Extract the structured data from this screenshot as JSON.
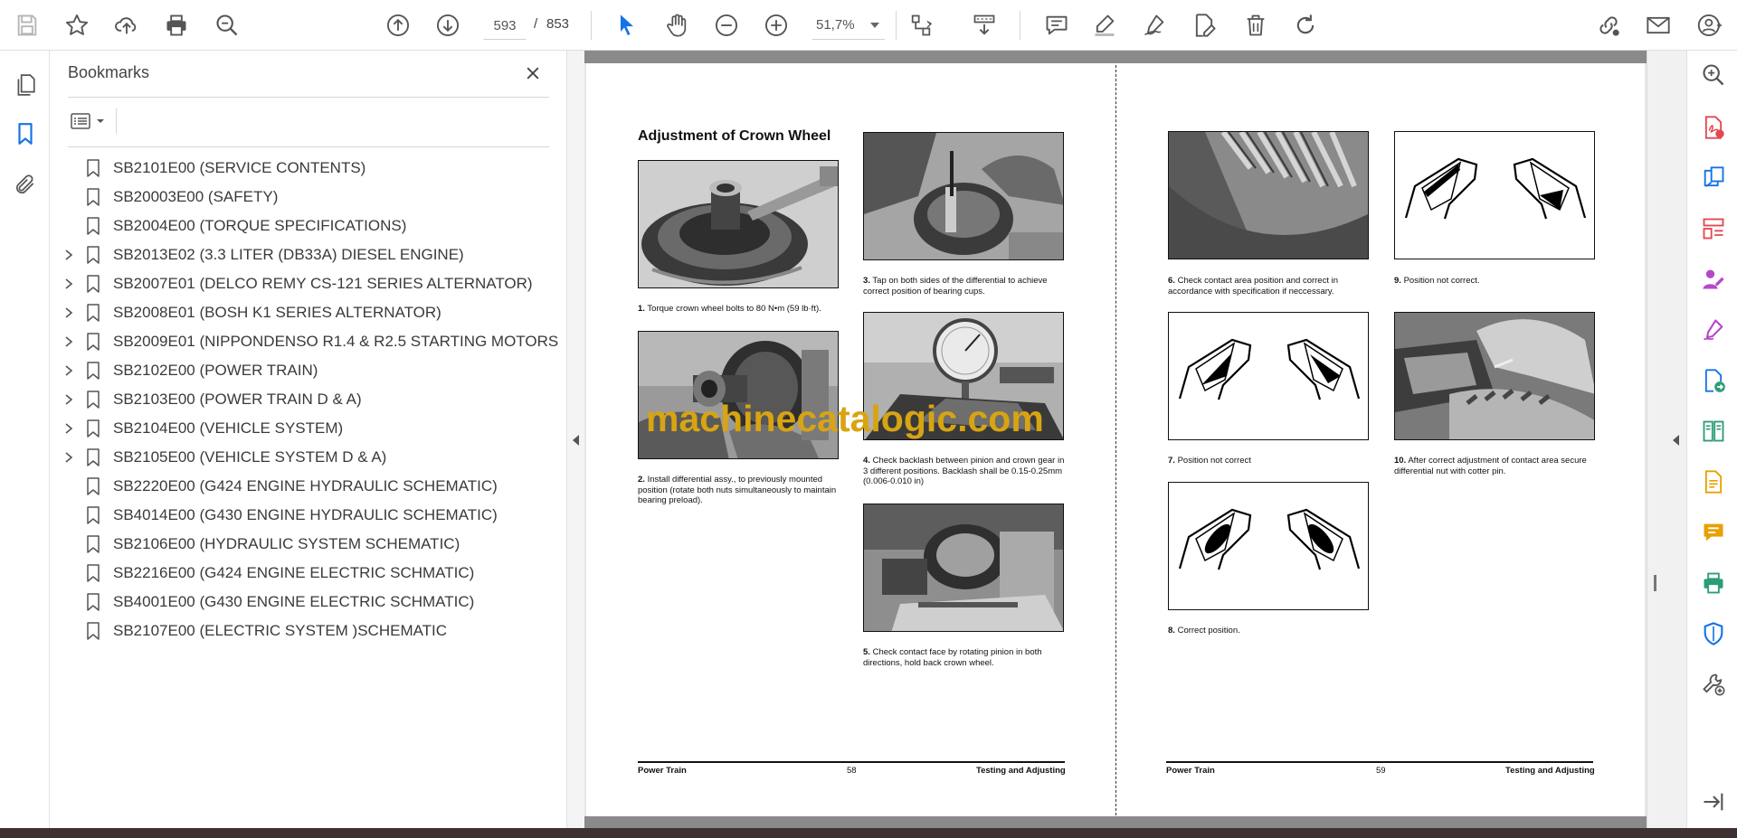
{
  "toolbar": {
    "current_page": "593",
    "separator": "/",
    "total_pages": "853",
    "zoom": "51,7%"
  },
  "bookmarks": {
    "title": "Bookmarks",
    "items": [
      {
        "label": "SB2101E00 (SERVICE CONTENTS)",
        "expandable": false
      },
      {
        "label": "SB20003E00 (SAFETY)",
        "expandable": false
      },
      {
        "label": "SB2004E00 (TORQUE SPECIFICATIONS)",
        "expandable": false
      },
      {
        "label": "SB2013E02 (3.3 LITER (DB33A) DIESEL ENGINE)",
        "expandable": true
      },
      {
        "label": "SB2007E01 (DELCO REMY CS-121 SERIES ALTERNATOR)",
        "expandable": true
      },
      {
        "label": "SB2008E01 (BOSH K1 SERIES ALTERNATOR)",
        "expandable": true
      },
      {
        "label": "SB2009E01 (NIPPONDENSO R1.4 & R2.5 STARTING MOTORS",
        "expandable": true
      },
      {
        "label": "SB2102E00 (POWER TRAIN)",
        "expandable": true
      },
      {
        "label": "SB2103E00 (POWER TRAIN D & A)",
        "expandable": true
      },
      {
        "label": "SB2104E00 (VEHICLE SYSTEM)",
        "expandable": true
      },
      {
        "label": "SB2105E00 (VEHICLE SYSTEM D & A)",
        "expandable": true
      },
      {
        "label": "SB2220E00 (G424 ENGINE HYDRAULIC SCHEMATIC)",
        "expandable": false
      },
      {
        "label": "SB4014E00 (G430 ENGINE HYDRAULIC SCHEMATIC)",
        "expandable": false
      },
      {
        "label": "SB2106E00 (HYDRAULIC SYSTEM SCHEMATIC)",
        "expandable": false
      },
      {
        "label": "SB2216E00 (G424 ENGINE ELECTRIC SCHMATIC)",
        "expandable": false
      },
      {
        "label": "SB4001E00 (G430 ENGINE ELECTRIC SCHMATIC)",
        "expandable": false
      },
      {
        "label": "SB2107E00 (ELECTRIC SYSTEM )SCHEMATIC",
        "expandable": false
      }
    ]
  },
  "document": {
    "left_page": {
      "heading": "Adjustment of Crown Wheel",
      "captions": [
        {
          "num": "1.",
          "text": "Torque crown wheel bolts to 80 N•m (59 lb·ft)."
        },
        {
          "num": "2.",
          "text": "Install differential assy., to previously mounted position (rotate both nuts simultaneously to maintain bearing preload)."
        },
        {
          "num": "3.",
          "text": "Tap on both sides of the differential to achieve correct position of bearing cups."
        },
        {
          "num": "4.",
          "text": "Check backlash between pinion and crown gear in 3 different positions. Backlash shall be 0.15-0.25mm (0.006-0.010 in)"
        },
        {
          "num": "5.",
          "text": "Check contact face by rotating pinion in both directions, hold back crown wheel."
        }
      ],
      "footer": {
        "section": "Power Train",
        "page": "58",
        "chapter": "Testing and Adjusting"
      }
    },
    "right_page": {
      "captions": [
        {
          "num": "6.",
          "text": "Check contact area position and correct in accordance with specification if neccessary."
        },
        {
          "num": "7.",
          "text": "Position not correct"
        },
        {
          "num": "8.",
          "text": "Correct position."
        },
        {
          "num": "9.",
          "text": "Position not correct."
        },
        {
          "num": "10.",
          "text": "After correct adjustment of contact area secure differential nut with cotter pin."
        }
      ],
      "footer": {
        "section": "Power Train",
        "page": "59",
        "chapter": "Testing and Adjusting"
      }
    },
    "watermark": "machinecatalogic.com"
  },
  "colors": {
    "accent_blue": "#1473e6",
    "right_rail_pink": "#e34850",
    "right_rail_purple": "#b648c8",
    "right_rail_green": "#2d9d78",
    "right_rail_yellow": "#e8a100",
    "watermark": "#d8a412"
  },
  "icons": {
    "toolbar": [
      "save-icon",
      "star-icon",
      "upload-icon",
      "print-icon",
      "find-icon",
      "prev-page-icon",
      "next-page-icon",
      "zoom-out-icon",
      "zoom-in-icon",
      "select-icon",
      "hand-icon",
      "fit-page-icon",
      "scroll-mode-icon",
      "comment-icon",
      "highlight-icon",
      "sign-icon",
      "edit-icon",
      "delete-icon",
      "rotate-icon",
      "share-link-icon",
      "mail-icon",
      "account-icon"
    ],
    "right_rail": [
      "zoom-tool-icon",
      "export-pdf-icon",
      "create-pdf-icon",
      "organize-pages-icon",
      "fill-sign-icon",
      "sign-pen-icon",
      "send-icon",
      "compare-icon",
      "scan-icon",
      "comment-tool-icon",
      "print-production-icon",
      "protect-icon",
      "more-tools-icon",
      "expand-icon"
    ]
  }
}
